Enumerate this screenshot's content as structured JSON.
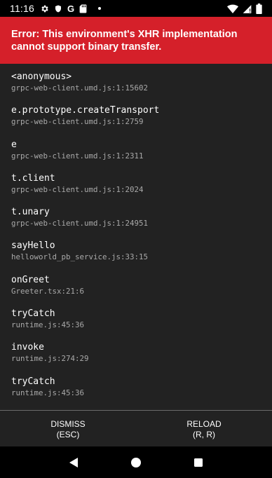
{
  "status_bar": {
    "time": "11:16",
    "icons": [
      "gear-icon",
      "shield-icon",
      "google-icon",
      "sd-card-icon",
      "dot-icon",
      "wifi-icon",
      "signal-icon",
      "battery-icon"
    ],
    "google_letter": "G"
  },
  "error": {
    "title": "Error: This environment's XHR implementation cannot support binary transfer.",
    "color": "#d5202a"
  },
  "stack_frames": [
    {
      "name": "<anonymous>",
      "location": "grpc-web-client.umd.js:1:15602"
    },
    {
      "name": "e.prototype.createTransport",
      "location": "grpc-web-client.umd.js:1:2759"
    },
    {
      "name": "e",
      "location": "grpc-web-client.umd.js:1:2311"
    },
    {
      "name": "t.client",
      "location": "grpc-web-client.umd.js:1:2024"
    },
    {
      "name": "t.unary",
      "location": "grpc-web-client.umd.js:1:24951"
    },
    {
      "name": "sayHello",
      "location": "helloworld_pb_service.js:33:15"
    },
    {
      "name": "onGreet",
      "location": "Greeter.tsx:21:6"
    },
    {
      "name": "tryCatch",
      "location": "runtime.js:45:36"
    },
    {
      "name": "invoke",
      "location": "runtime.js:274:29"
    },
    {
      "name": "tryCatch",
      "location": "runtime.js:45:36"
    }
  ],
  "buttons": {
    "dismiss_label": "DISMISS",
    "dismiss_shortcut": "(ESC)",
    "reload_label": "RELOAD",
    "reload_shortcut": "(R, R)"
  },
  "nav_bar": {
    "icons": [
      "back-icon",
      "home-icon",
      "recents-icon"
    ]
  }
}
